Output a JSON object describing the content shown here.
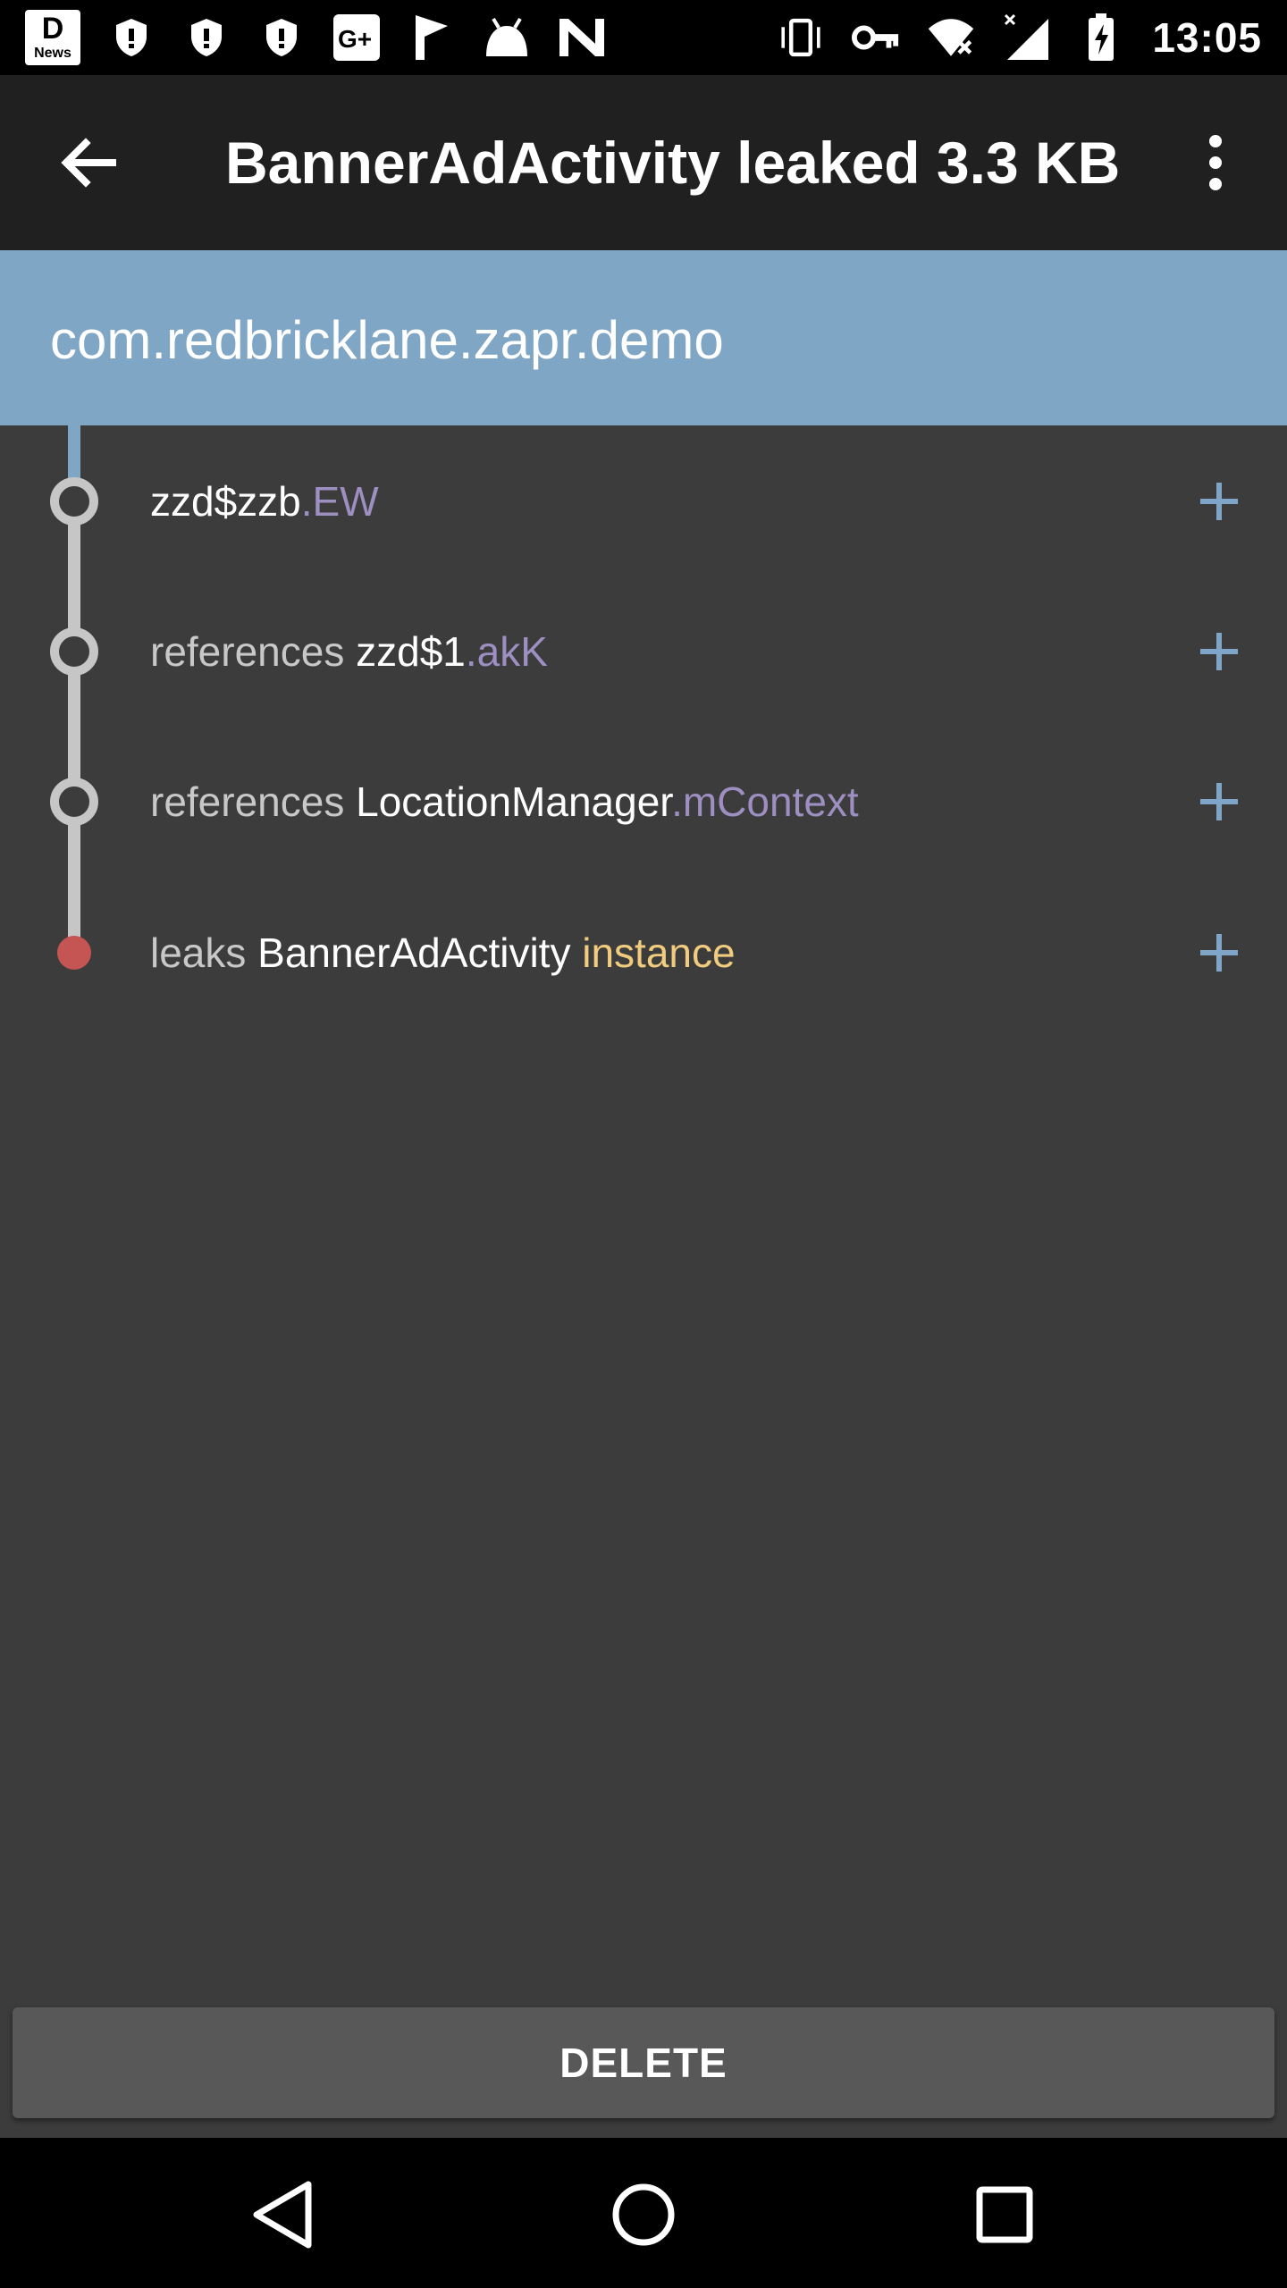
{
  "status_bar": {
    "time": "13:05",
    "news_label": "News",
    "left_icons": [
      "news-icon",
      "shield-icon",
      "shield-icon",
      "shield-icon",
      "google-plus-icon",
      "flag-icon",
      "android-icon",
      "n-icon"
    ],
    "right_icons": [
      "vibrate-icon",
      "key-icon",
      "wifi-icon",
      "signal-icon",
      "battery-charging-icon"
    ]
  },
  "toolbar": {
    "title": "BannerAdActivity leaked 3.3 KB",
    "back_icon": "arrow-back-icon",
    "overflow_icon": "more-vert-icon"
  },
  "header": {
    "package": "com.redbricklane.zapr.demo"
  },
  "trace": {
    "rows": [
      {
        "prefix": "",
        "class": "zzd$zzb",
        "field": ".EW",
        "suffix": ""
      },
      {
        "prefix": "references ",
        "class": "zzd$1",
        "field": ".akK",
        "suffix": ""
      },
      {
        "prefix": "references ",
        "class": "LocationManager",
        "field": ".mContext",
        "suffix": ""
      },
      {
        "prefix": "leaks ",
        "class": "BannerAdActivity",
        "field": "",
        "suffix": " instance"
      }
    ],
    "expand_icon": "plus-icon"
  },
  "actions": {
    "delete_label": "DELETE"
  },
  "nav": {
    "back_icon": "nav-back-icon",
    "home_icon": "nav-home-icon",
    "recents_icon": "nav-recents-icon"
  },
  "colors": {
    "header_bg": "#80a6c6",
    "toolbar_bg": "#202020",
    "content_bg": "#3c3c3c",
    "field_purple": "#9d8fc1",
    "instance_gold": "#f1cc7e",
    "leak_red": "#c45552",
    "plus_blue": "#7fa6c8"
  }
}
